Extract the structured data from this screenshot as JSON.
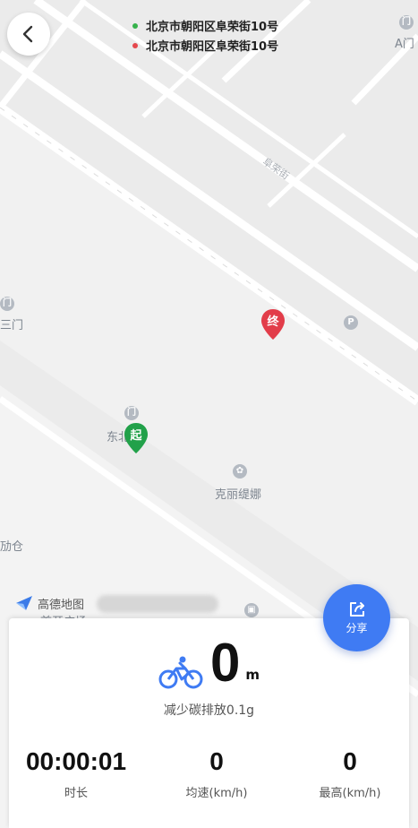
{
  "route": {
    "start_address": "北京市朝阳区阜荣街10号",
    "end_address": "北京市朝阳区阜荣街10号",
    "start_dot_color": "#35b24b",
    "end_dot_color": "#e5484d"
  },
  "map": {
    "labels": {
      "gate_a": "A门",
      "third_gate": "三门",
      "east_gate": "东北门",
      "kelitina": "克丽缇娜",
      "warehouse": "劢仓",
      "plaza": "首开广场",
      "street": "阜荣街"
    },
    "pins": {
      "start": "起",
      "end": "终"
    },
    "logo_text": "高德地图"
  },
  "share": {
    "label": "分享"
  },
  "summary": {
    "distance_value": "0",
    "distance_unit": "m",
    "carbon_text": "减少碳排放0.1g",
    "duration_value": "00:00:01",
    "duration_label": "时长",
    "avg_speed_value": "0",
    "avg_speed_label": "均速(km/h)",
    "max_speed_value": "0",
    "max_speed_label": "最高(km/h)"
  },
  "icons": {
    "back": "chevron-left-icon",
    "bike": "bicycle-icon",
    "share": "share-icon"
  },
  "colors": {
    "accent": "#3f7bf3",
    "start_pin": "#22a14a",
    "end_pin": "#e23d4a"
  }
}
